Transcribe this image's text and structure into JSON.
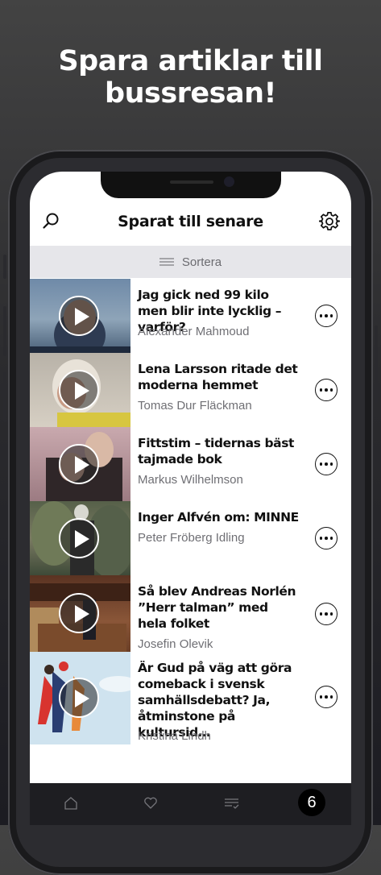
{
  "promo": {
    "line1": "Spara artiklar till",
    "line2": "bussresan!"
  },
  "header": {
    "title": "Sparat till senare"
  },
  "sort": {
    "label": "Sortera"
  },
  "articles": [
    {
      "title": "Jag gick ned 99 kilo men blir inte lycklig – varför?",
      "author": "Alexander  Mahmoud"
    },
    {
      "title": "Lena Larsson ritade det moderna hemmet",
      "author": "Tomas  Dur Fläckman"
    },
    {
      "title": "Fittstim – tidernas bäst tajmade bok",
      "author": "Markus Wilhelmson"
    },
    {
      "title": "Inger Alfvén om: MINNE",
      "author": "Peter Fröberg Idling"
    },
    {
      "title": "Så blev Andreas Norlén ”Herr talman” med hela folket",
      "author": "Josefin Olevik"
    },
    {
      "title": "Är Gud på väg att göra comeback i svensk samhällsdebatt? Ja, åtminstone på kultursid…",
      "author": "Kristina Lindh"
    }
  ],
  "tabbar": {
    "saved_count": "6"
  },
  "colors": {
    "background": "#2b2b2e",
    "sort_bar": "#e6e6ea",
    "tabbar": "#1e1e22"
  }
}
